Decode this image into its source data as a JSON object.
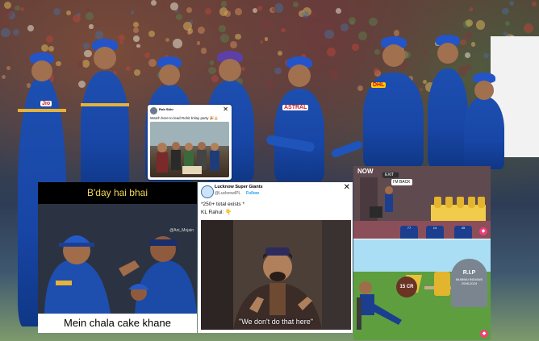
{
  "tweet_card": {
    "name": "Rob Sbhr",
    "text": "Watch here to lead Rohit b'day party 🎉🎂",
    "close": "✕"
  },
  "meme1": {
    "caption_top": "B'day hai bhai",
    "handle": "@Ani_Mojain",
    "caption_bottom": "Mein chala cake khane"
  },
  "tweet2": {
    "account_name": "Lucknow Super Giants",
    "handle": "@LucknowIPL",
    "follow": "Follow",
    "line1": "*250+ total exists *",
    "line2": "KL Rahul: 👇",
    "subtitle": "\"We don't do that here\"",
    "close": "✕"
  },
  "meme3": {
    "now": "NOW",
    "im_back": "I'M BACK",
    "exit": "EXIT",
    "jerseys": [
      "77",
      "14",
      "45"
    ],
    "cr_badge": "15 CR",
    "grave_rip": "R.I.P",
    "grave_team": "MUMBAI INDIANS",
    "grave_years": "2008-2024"
  },
  "background": {
    "sponsor_dhl": "DHL",
    "sponsor_jio": "Jio",
    "sponsor_astral": "ASTRAL"
  }
}
